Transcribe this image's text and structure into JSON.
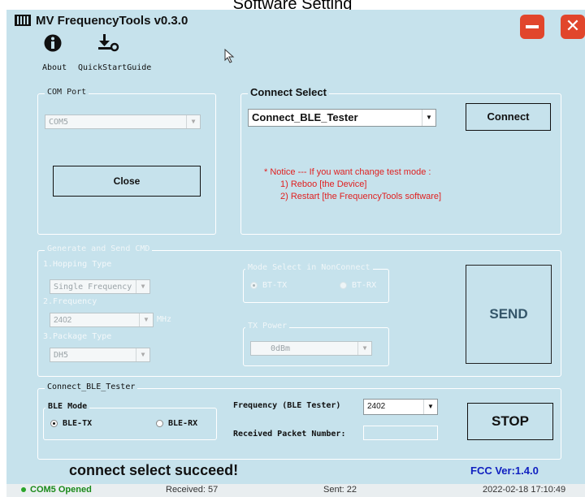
{
  "caption": "Software Setting",
  "app": {
    "title": "MV FrequencyTools v0.3.0"
  },
  "toolbar": {
    "about_label": "About",
    "quickstart_label": "QuickStartGuide"
  },
  "window_controls": {
    "minimize": "minimize",
    "close": "close"
  },
  "com_port": {
    "legend": "COM Port",
    "port_value": "COM5",
    "close_button": "Close"
  },
  "connect_select": {
    "legend": "Connect Select",
    "mode_value": "Connect_BLE_Tester",
    "connect_button": "Connect",
    "notice_line1": "* Notice --- If you want change test mode :",
    "notice_line2": "1) Reboo [the Device]",
    "notice_line3": "2) Restart [the FrequencyTools software]"
  },
  "generate": {
    "legend": "Generate and Send CMD",
    "hopping_label": "1.Hopping Type",
    "hopping_value": "Single Frequency",
    "frequency_label": "2.Frequency",
    "frequency_value": "2402",
    "frequency_unit": "MHz",
    "package_label": "3.Package Type",
    "package_value": "DH5",
    "mode_legend": "Mode Select in NonConnect",
    "bt_tx": "BT-TX",
    "bt_rx": "BT-RX",
    "tx_power_legend": "TX Power",
    "tx_power_value": "0dBm",
    "send_button": "SEND"
  },
  "ble_tester": {
    "legend": "Connect_BLE_Tester",
    "ble_mode_legend": "BLE Mode",
    "ble_tx": "BLE-TX",
    "ble_rx": "BLE-RX",
    "frequency_label": "Frequency (BLE Tester)",
    "frequency_value": "2402",
    "received_label": "Received Packet Number:",
    "received_value": "",
    "stop_button": "STOP"
  },
  "status": {
    "message": "connect select succeed!",
    "fcc_version": "FCC Ver:1.4.0",
    "com_state": "COM5 Opened",
    "received": "Received: 57",
    "sent": "Sent: 22",
    "timestamp": "2022-02-18 17:10:49"
  },
  "colors": {
    "background": "#c6e2ec",
    "accent_red": "#e1462c",
    "notice_red": "#e02020",
    "fcc_blue": "#1020c0"
  },
  "icons": [
    "info-icon",
    "download-gear-icon",
    "minimize-icon",
    "close-icon",
    "cursor-icon"
  ]
}
